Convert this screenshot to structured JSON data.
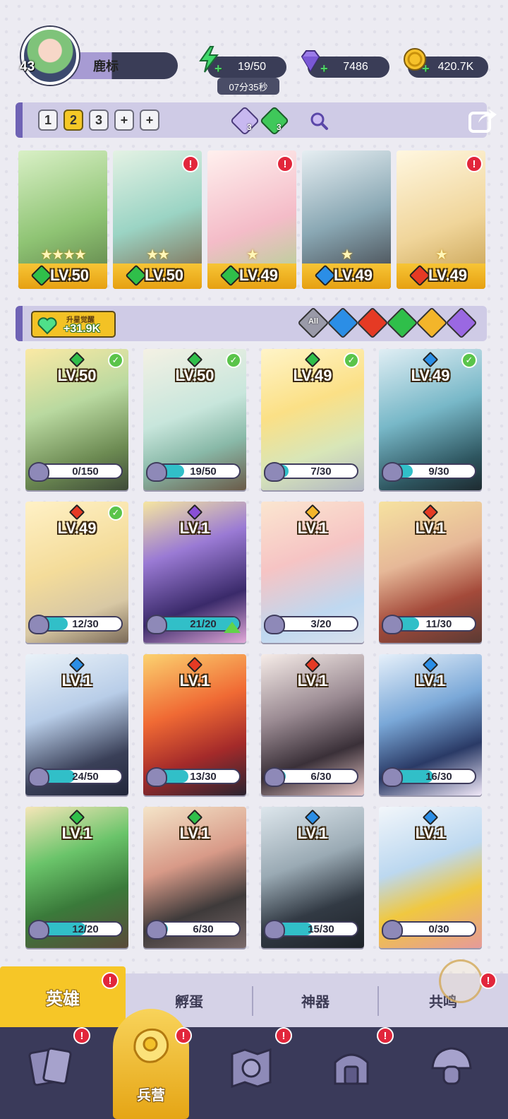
{
  "player": {
    "level": "43",
    "name": "鹿标"
  },
  "resources": {
    "energy": "19/50",
    "energy_timer": "07分35秒",
    "gems": "7486",
    "gold": "420.7K"
  },
  "team": {
    "slots": [
      "1",
      "2",
      "3"
    ],
    "active_slot": "2",
    "gem_counts": [
      "3",
      "3"
    ],
    "heroes": [
      {
        "level": "LV.50",
        "element": "wind",
        "stars": "★★★★",
        "alert": false
      },
      {
        "level": "LV.50",
        "element": "wind",
        "stars": "★★",
        "alert": true
      },
      {
        "level": "LV.49",
        "element": "wind",
        "stars": "★",
        "alert": true
      },
      {
        "level": "LV.49",
        "element": "water",
        "stars": "★",
        "alert": false
      },
      {
        "level": "LV.49",
        "element": "fire",
        "stars": "★",
        "alert": true
      }
    ]
  },
  "filter": {
    "awaken_label": "升星觉醒",
    "awaken_value": "+31.9K",
    "all_label": "All",
    "elements": [
      "all",
      "water",
      "fire",
      "wind",
      "light",
      "dark"
    ]
  },
  "heroes": [
    {
      "level": "LV.50",
      "element": "wind",
      "shards": "0/150",
      "fill": 0.0,
      "checked": true,
      "upgradable": false
    },
    {
      "level": "LV.50",
      "element": "wind",
      "shards": "19/50",
      "fill": 0.38,
      "checked": true,
      "upgradable": false
    },
    {
      "level": "LV.49",
      "element": "wind",
      "shards": "7/30",
      "fill": 0.23,
      "checked": true,
      "upgradable": false
    },
    {
      "level": "LV.49",
      "element": "water",
      "shards": "9/30",
      "fill": 0.3,
      "checked": true,
      "upgradable": false
    },
    {
      "level": "LV.49",
      "element": "fire",
      "shards": "12/30",
      "fill": 0.4,
      "checked": true,
      "upgradable": false
    },
    {
      "level": "LV.1",
      "element": "dark",
      "shards": "21/20",
      "fill": 1.0,
      "checked": false,
      "upgradable": true
    },
    {
      "level": "LV.1",
      "element": "light",
      "shards": "3/20",
      "fill": 0.15,
      "checked": false,
      "upgradable": false
    },
    {
      "level": "LV.1",
      "element": "fire",
      "shards": "11/30",
      "fill": 0.37,
      "checked": false,
      "upgradable": false
    },
    {
      "level": "LV.1",
      "element": "water",
      "shards": "24/50",
      "fill": 0.48,
      "checked": false,
      "upgradable": false
    },
    {
      "level": "LV.1",
      "element": "fire",
      "shards": "13/30",
      "fill": 0.43,
      "checked": false,
      "upgradable": false
    },
    {
      "level": "LV.1",
      "element": "fire",
      "shards": "6/30",
      "fill": 0.2,
      "checked": false,
      "upgradable": false
    },
    {
      "level": "LV.1",
      "element": "water",
      "shards": "16/30",
      "fill": 0.53,
      "checked": false,
      "upgradable": false
    },
    {
      "level": "LV.1",
      "element": "wind",
      "shards": "12/20",
      "fill": 0.6,
      "checked": false,
      "upgradable": false
    },
    {
      "level": "LV.1",
      "element": "wind",
      "shards": "6/30",
      "fill": 0.2,
      "checked": false,
      "upgradable": false
    },
    {
      "level": "LV.1",
      "element": "water",
      "shards": "15/30",
      "fill": 0.5,
      "checked": false,
      "upgradable": false
    },
    {
      "level": "LV.1",
      "element": "water",
      "shards": "0/30",
      "fill": 0.0,
      "checked": false,
      "upgradable": false
    }
  ],
  "sub_tabs": [
    {
      "label": "英雄",
      "active": true,
      "alert": true
    },
    {
      "label": "孵蛋",
      "active": false,
      "alert": false
    },
    {
      "label": "神器",
      "active": false,
      "alert": false
    },
    {
      "label": "共鸣",
      "active": false,
      "alert": true
    }
  ],
  "bottom_nav": [
    {
      "icon": "cards-icon",
      "alert": true
    },
    {
      "icon": "barracks-icon",
      "label": "兵营",
      "active": true,
      "alert": true
    },
    {
      "icon": "map-icon",
      "alert": true
    },
    {
      "icon": "shrine-icon",
      "alert": true
    },
    {
      "icon": "mushroom-icon",
      "alert": false
    }
  ],
  "element_colors": {
    "wind": "#2fbf4a",
    "water": "#2b8ee6",
    "fire": "#e53a24",
    "light": "#f3b52a",
    "dark": "#8a4fd6",
    "all": "#9a9aa8"
  }
}
